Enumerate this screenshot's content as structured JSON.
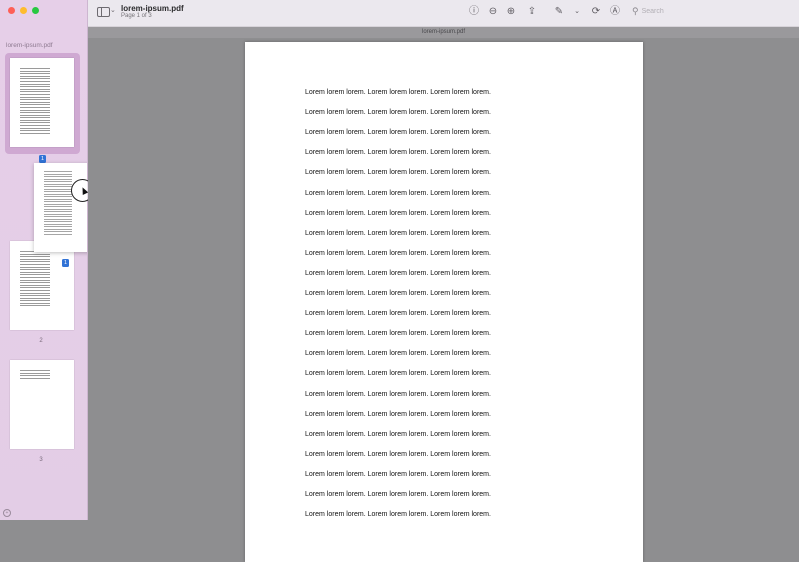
{
  "window": {
    "title": "lorem-ipsum.pdf",
    "subtitle": "Page 1 of 3"
  },
  "sidebar": {
    "doc_name": "lorem-ipsum.pdf",
    "pages": [
      {
        "number": "1",
        "badge": "1"
      },
      {
        "number": "2",
        "badge": "1"
      },
      {
        "number": "3"
      }
    ]
  },
  "toolbar": {
    "search_placeholder": "Search",
    "icons": [
      "sidebar-toggle-icon",
      "info-icon",
      "zoom-out-icon",
      "zoom-in-icon",
      "share-icon",
      "markup-icon",
      "chevron-down-icon",
      "rotate-icon",
      "annotate-icon",
      "search-icon"
    ]
  },
  "document": {
    "title": "lorem-ipsum.pdf",
    "lines": [
      "Lorem lorem lorem. Lorem lorem lorem. Lorem lorem lorem.",
      "Lorem lorem lorem. Lorem lorem lorem. Lorem lorem lorem.",
      "Lorem lorem lorem. Lorem lorem lorem. Lorem lorem lorem.",
      "Lorem lorem lorem. Lorem lorem lorem. Lorem lorem lorem.",
      "Lorem lorem lorem. Lorem lorem lorem. Lorem lorem lorem.",
      "Lorem lorem lorem. Lorem lorem lorem. Lorem lorem lorem.",
      "Lorem lorem lorem. Lorem lorem lorem. Lorem lorem lorem.",
      "Lorem lorem lorem. Lorem lorem lorem. Lorem lorem lorem.",
      "Lorem lorem lorem. Lorem lorem lorem. Lorem lorem lorem.",
      "Lorem lorem lorem. Lorem lorem lorem. Lorem lorem lorem.",
      "Lorem lorem lorem. Lorem lorem lorem. Lorem lorem lorem.",
      "Lorem lorem lorem. Lorem lorem lorem. Lorem lorem lorem.",
      "Lorem lorem lorem. Lorem lorem lorem. Lorem lorem lorem.",
      "Lorem lorem lorem. Lorem lorem lorem. Lorem lorem lorem.",
      "Lorem lorem lorem. Lorem lorem lorem. Lorem lorem lorem.",
      "Lorem lorem lorem. Lorem lorem lorem. Lorem lorem lorem.",
      "Lorem lorem lorem. Lorem lorem lorem. Lorem lorem lorem.",
      "Lorem lorem lorem. Lorem lorem lorem. Lorem lorem lorem.",
      "Lorem lorem lorem. Lorem lorem lorem. Lorem lorem lorem.",
      "Lorem lorem lorem. Lorem lorem lorem. Lorem lorem lorem.",
      "Lorem lorem lorem. Lorem lorem lorem. Lorem lorem lorem.",
      "Lorem lorem lorem. Lorem lorem lorem. Lorem lorem lorem."
    ]
  },
  "colors": {
    "sidebar_bg": "#e5cee7",
    "selection": "#cfa9d2",
    "badge": "#3173d6",
    "canvas": "#8e8e90"
  }
}
